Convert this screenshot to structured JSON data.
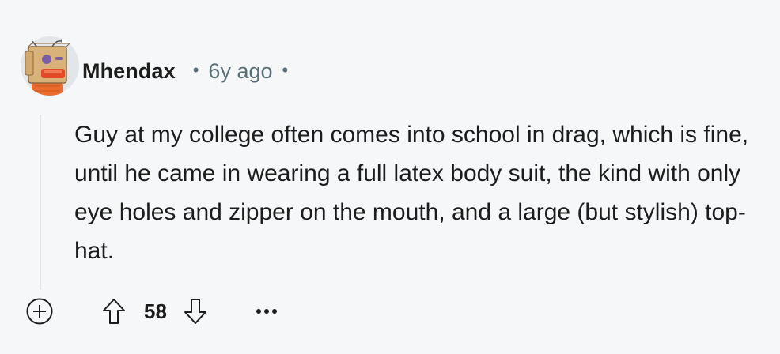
{
  "comment": {
    "author": "Mhendax",
    "separator": "•",
    "time": "6y ago",
    "body": "Guy at my college often comes into school in drag, which is fine, until he came in wearing a full latex body suit, the kind with only eye holes and zipper on the mouth, and a large (but stylish) top-hat.",
    "score": "58"
  },
  "icons": {
    "avatar": "robot-avatar",
    "expand": "plus-circle-icon",
    "upvote": "upvote-arrow-icon",
    "downvote": "downvote-arrow-icon",
    "more": "ellipsis-icon"
  },
  "colors": {
    "background": "#f6f7f8",
    "text": "#1c1c1c",
    "meta": "#576f76",
    "thread_line": "#dfe3e6"
  }
}
